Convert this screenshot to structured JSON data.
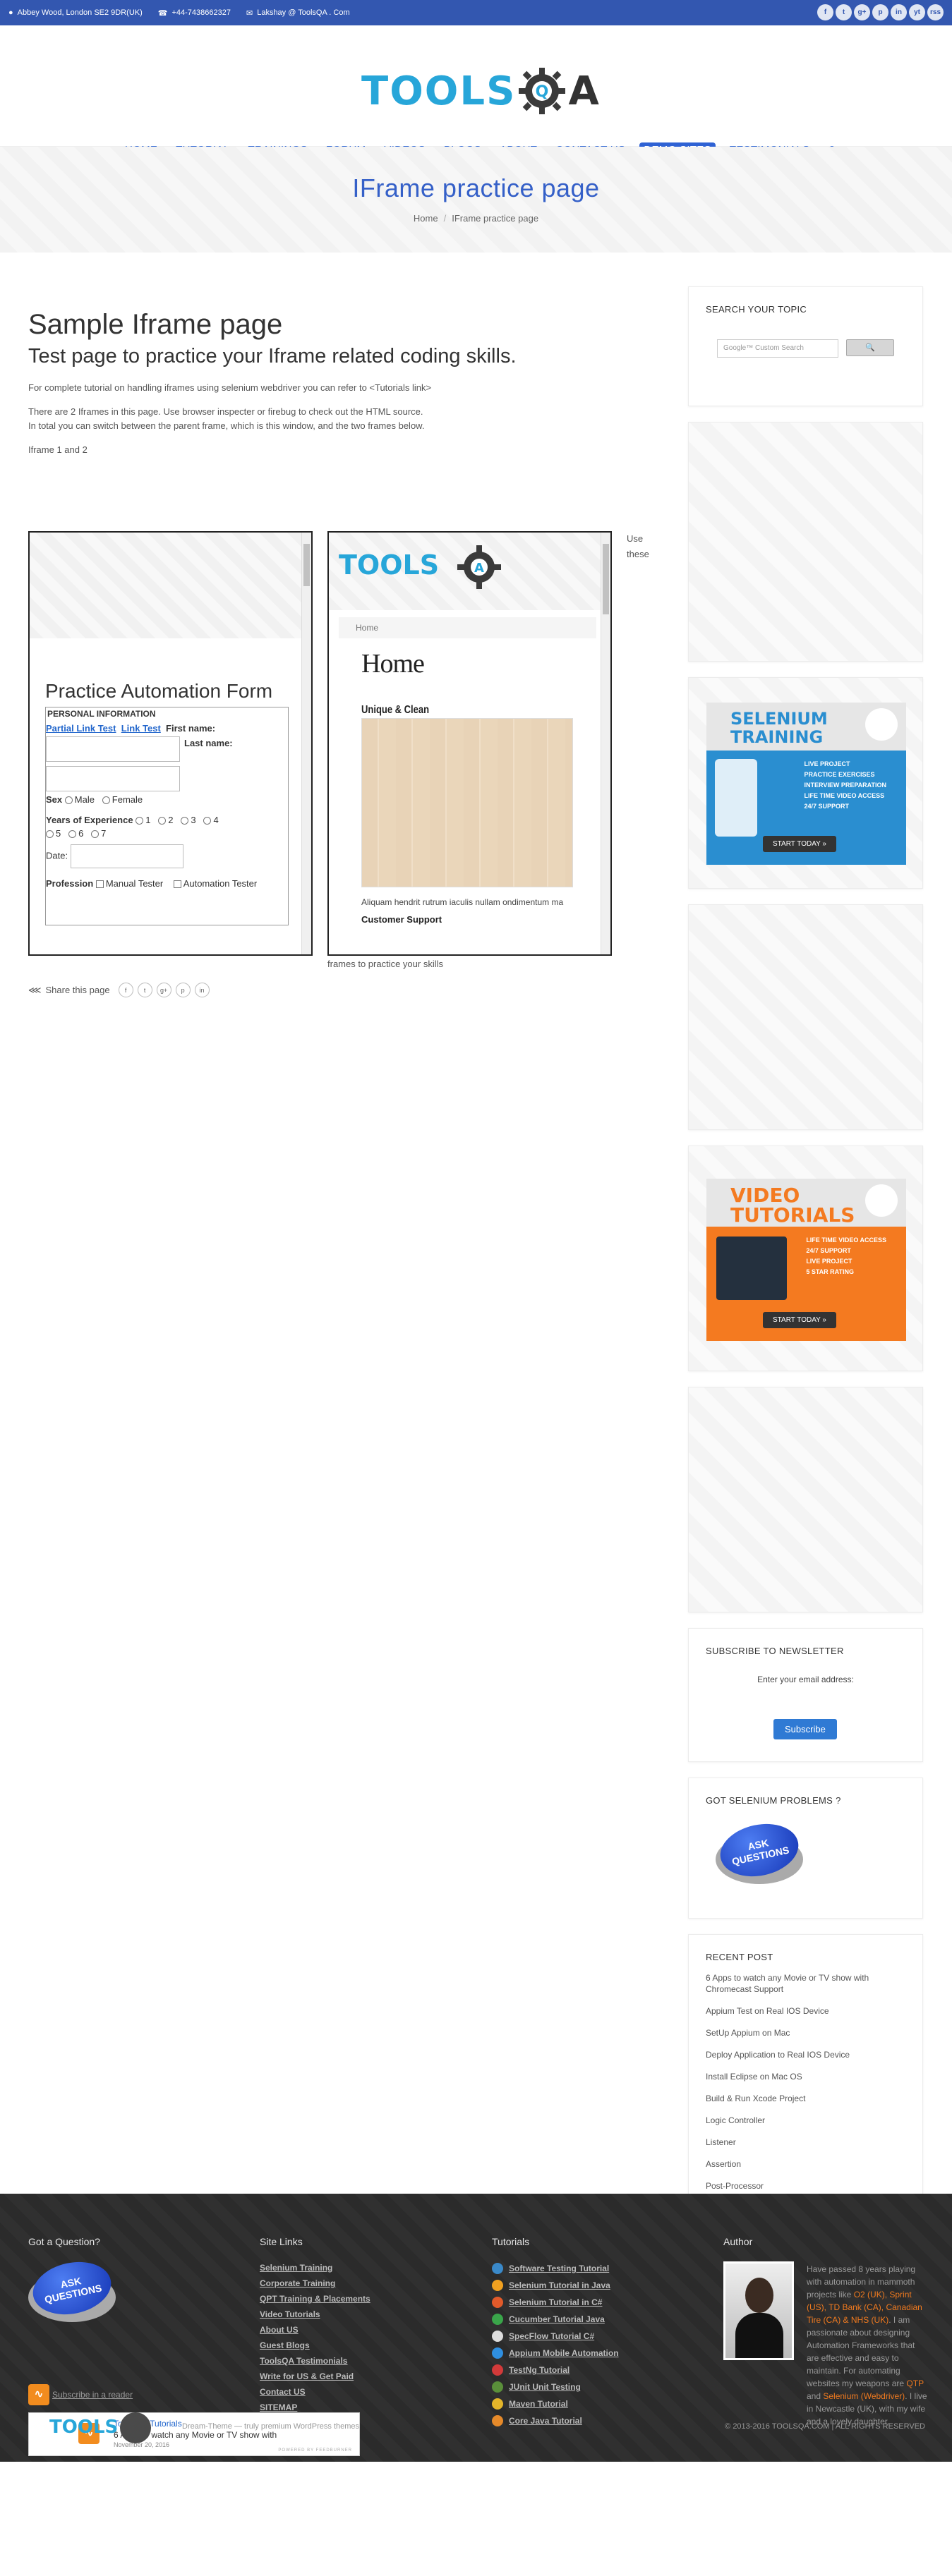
{
  "topbar": {
    "address": "Abbey Wood, London SE2 9DR(UK)",
    "phone": "+44-7438662327",
    "email": "Lakshay @ ToolsQA . Com",
    "social": [
      "f",
      "t",
      "g+",
      "p",
      "in",
      "yt",
      "rss"
    ]
  },
  "logo": {
    "text": "TOOLS",
    "suffix": "A"
  },
  "nav": {
    "items": [
      "HOME",
      "TUTORIAL",
      "TRAININGS",
      "FORUM",
      "VIDEOS",
      "BLOGS",
      "ABOUT",
      "CONTACT US",
      "DEMO SITES",
      "TESTIMONIALS"
    ],
    "active": "DEMO SITES"
  },
  "page": {
    "title": "IFrame practice page",
    "breadcrumb": [
      "Home",
      "IFrame practice page"
    ]
  },
  "content": {
    "heading": "Sample Iframe page",
    "subheading": "Test page to practice your Iframe related coding skills.",
    "para1": "For complete tutorial on handling iframes using selenium webdriver you can refer to <Tutorials link>",
    "para2": "There are 2 Iframes in this page. Use browser inspecter or firebug to check out the HTML source.",
    "para3": "In total you can switch between the parent frame, which is this window, and the two frames below.",
    "para4": "Iframe 1 and 2",
    "use_these": "Use these",
    "frames_text": "frames to practice your skills",
    "share": "Share this page",
    "share_icons": [
      "f",
      "t",
      "g+",
      "p",
      "in"
    ]
  },
  "iframe1": {
    "title": "Practice Automation Form",
    "legend": "PERSONAL INFORMATION",
    "link1": "Partial Link Test",
    "link2": "Link Test",
    "first_name": "First name:",
    "last_name": "Last name:",
    "sex": "Sex",
    "male": "Male",
    "female": "Female",
    "experience": "Years of Experience",
    "exp_options": [
      "1",
      "2",
      "3",
      "4",
      "5",
      "6",
      "7"
    ],
    "date": "Date:",
    "profession": "Profession",
    "manual": "Manual Tester",
    "automation": "Automation Tester"
  },
  "iframe2": {
    "logo": "TOOLS",
    "breadcrumb": "Home",
    "heading": "Home",
    "subtitle": "Unique & Clean",
    "text": "Aliquam hendrit rutrum iaculis nullam ondimentum ma",
    "section": "Customer Support"
  },
  "sidebar": {
    "search_title": "SEARCH YOUR TOPIC",
    "search_placeholder": "Google™ Custom Search",
    "search_button": "🔍",
    "selenium_promo": {
      "title": "SELENIUM TRAINING",
      "bullets": [
        "LIVE PROJECT",
        "PRACTICE EXERCISES",
        "INTERVIEW PREPARATION",
        "LIFE TIME VIDEO ACCESS",
        "24/7 SUPPORT"
      ],
      "cta": "START TODAY »"
    },
    "video_promo": {
      "title": "VIDEO TUTORIALS",
      "bullets": [
        "LIFE TIME VIDEO ACCESS",
        "24/7 SUPPORT",
        "LIVE PROJECT",
        "5 STAR RATING"
      ],
      "cta": "START TODAY »"
    },
    "newsletter_title": "SUBSCRIBE TO NEWSLETTER",
    "newsletter_label": "Enter your email address:",
    "newsletter_button": "Subscribe",
    "problems_title": "GOT SELENIUM PROBLEMS ?",
    "ask_text": "ASK QUESTIONS",
    "recent_title": "RECENT POST",
    "recent_posts": [
      "6 Apps to watch any Movie or TV show with Chromecast Support",
      "Appium Test on Real IOS Device",
      "SetUp Appium on Mac",
      "Deploy Application to Real IOS Device",
      "Install Eclipse on Mac OS",
      "Build & Run Xcode Project",
      "Logic Controller",
      "Listener",
      "Assertion",
      "Post-Processor"
    ]
  },
  "footer": {
    "q_title": "Got a Question?",
    "ask_text": "ASK QUESTIONS",
    "subscribe_reader": "Subscribe in a reader",
    "feed": {
      "name": "Tools QA Tutorials",
      "post": "6 Apps to watch any Movie or TV show with",
      "date": "November 20, 2016",
      "powered": "POWERED BY FEEDBURNER"
    },
    "links_title": "Site Links",
    "links": [
      "Selenium Training",
      "Corporate Training",
      "QPT Training & Placements",
      "Video Tutorials",
      "About US",
      "Guest Blogs",
      "ToolsQA Testimonials",
      "Write for US & Get Paid",
      "Contact US",
      "SITEMAP"
    ],
    "tutorials_title": "Tutorials",
    "tutorials": [
      {
        "label": "Software Testing Tutorial",
        "color": "#3a89c9"
      },
      {
        "label": "Selenium Tutorial in Java",
        "color": "#f0a020"
      },
      {
        "label": "Selenium Tutorial in C#",
        "color": "#e25a2a"
      },
      {
        "label": "Cucumber Tutorial Java",
        "color": "#3aa54a"
      },
      {
        "label": "SpecFlow Tutorial C#",
        "color": "#dddddd"
      },
      {
        "label": "Appium Mobile Automation",
        "color": "#2f8fe0"
      },
      {
        "label": "TestNg Tutorial",
        "color": "#d23a3a"
      },
      {
        "label": "JUnit Unit Testing",
        "color": "#5a8f3a"
      },
      {
        "label": "Maven Tutorial",
        "color": "#e4b52a"
      },
      {
        "label": "Core Java Tutorial",
        "color": "#e68a2a"
      }
    ],
    "author_title": "Author",
    "author_text_1": "Have passed 8 years playing with automation in mammoth projects like ",
    "author_hl_1": "O2 (UK), Sprint (US), TD Bank (CA), Canadian Tire (CA) & NHS (UK)",
    "author_text_2": ". I am passionate about designing Automation Frameworks that are effective and easy to maintain. For automating websites my weapons are ",
    "author_hl_2": "QTP",
    "author_text_3": " and ",
    "author_hl_3": "Selenium (Webdriver)",
    "author_text_4": ". I live in Newcastle (UK), with my wife and a lovely daughter.",
    "bottom_logo": "TOOLS",
    "credit": "Dream-Theme — truly premium WordPress themes",
    "copyright": "© 2013-2016 TOOLSQA.COM | ALL RIGHTS RESERVED"
  }
}
